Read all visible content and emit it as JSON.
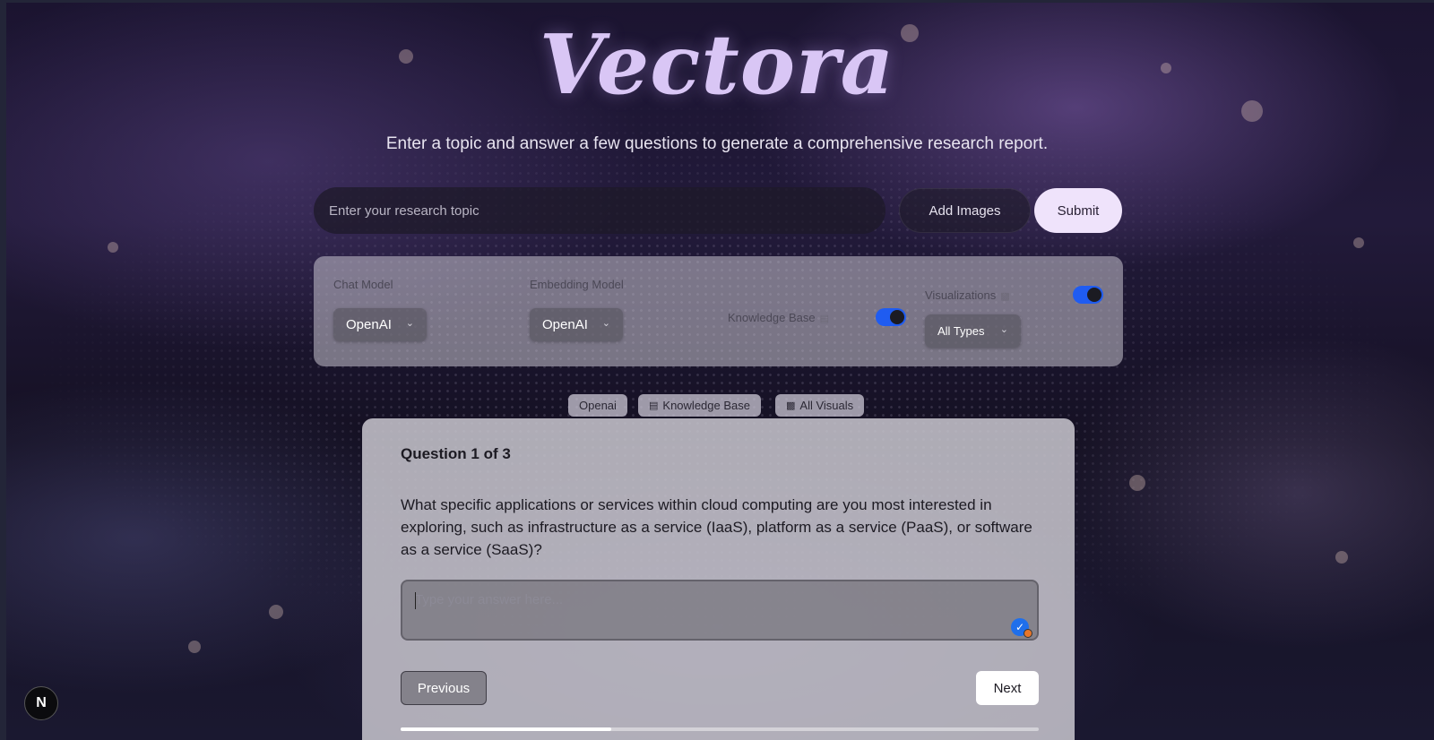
{
  "app": {
    "logo": "Vectora",
    "subtitle": "Enter a topic and answer a few questions to generate a comprehensive research report."
  },
  "search": {
    "placeholder": "Enter your research topic",
    "value": "",
    "add_images_label": "Add Images",
    "submit_label": "Submit"
  },
  "settings": {
    "chat_model": {
      "label": "Chat Model",
      "value": "OpenAI"
    },
    "embedding_model": {
      "label": "Embedding Model",
      "value": "OpenAI"
    },
    "knowledge_base": {
      "label": "Knowledge Base",
      "icon": "database-icon",
      "enabled": true
    },
    "visualizations": {
      "label": "Visualizations",
      "icon": "bar-chart-icon",
      "enabled": true,
      "type_value": "All Types"
    },
    "toggle_color": "#1f5cf1"
  },
  "chips": [
    {
      "label": "Openai"
    },
    {
      "label": "Knowledge Base",
      "icon": "database-icon"
    },
    {
      "label": "All Visuals",
      "icon": "bar-chart-icon"
    }
  ],
  "question": {
    "counter": "Question 1 of 3",
    "text": "What specific applications or services within cloud computing are you most interested in exploring, such as infrastructure as a service (IaaS), platform as a service (PaaS), or software as a service (SaaS)?",
    "answer_placeholder": "Type your answer here...",
    "answer_value": "",
    "previous_label": "Previous",
    "next_label": "Next",
    "progress": 0.33
  },
  "framework_badge": {
    "label": "N"
  }
}
